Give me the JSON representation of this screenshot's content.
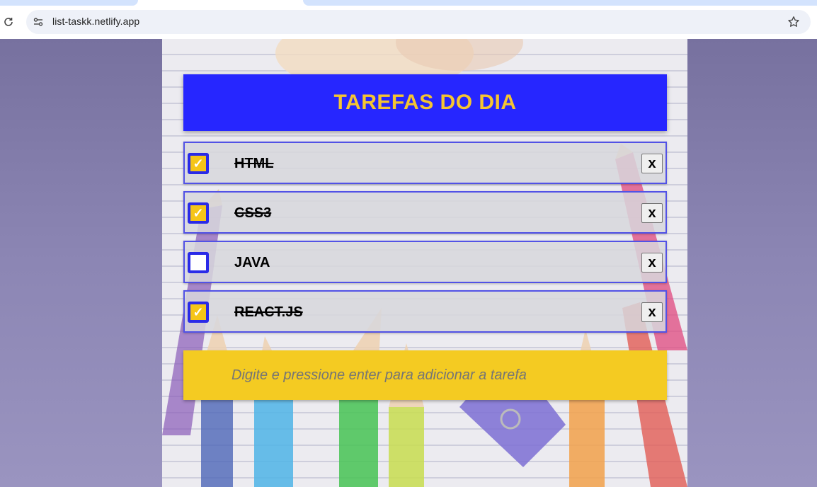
{
  "browser": {
    "url": "list-taskk.netlify.app"
  },
  "app": {
    "title": "TAREFAS DO DIA",
    "tasks": [
      {
        "label": "HTML",
        "done": true,
        "delete_label": "x"
      },
      {
        "label": "CSS3",
        "done": true,
        "delete_label": "x"
      },
      {
        "label": "JAVA",
        "done": false,
        "delete_label": "x"
      },
      {
        "label": "REACT.JS",
        "done": true,
        "delete_label": "x"
      }
    ],
    "new_task": {
      "placeholder": "Digite e pressione enter para adicionar a tarefa",
      "value": ""
    }
  },
  "colors": {
    "header_bg": "#2626ff",
    "title": "#f5c531",
    "checkbox_border": "#2a2ae8",
    "checkbox_checked": "#f5c518",
    "input_bg": "#f4cb22"
  },
  "icons": {
    "reload": "reload-icon",
    "site_info": "site-info-icon",
    "bookmark": "star-icon",
    "check": "check-icon"
  }
}
